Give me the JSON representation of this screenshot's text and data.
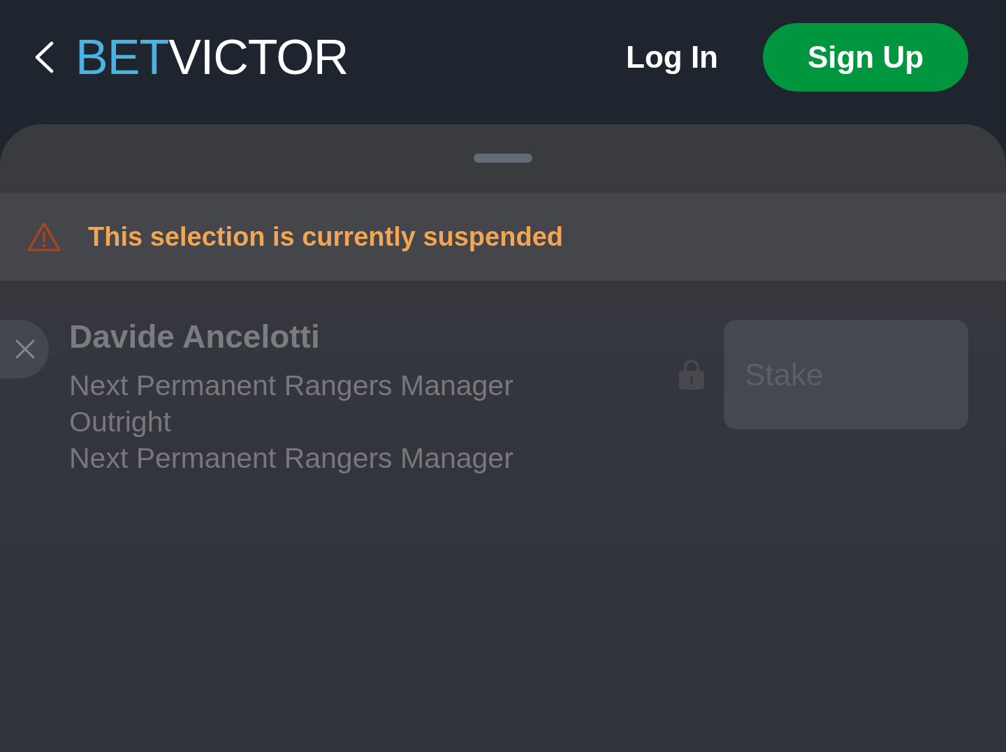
{
  "header": {
    "logo": {
      "accent": "BET",
      "rest": "VICTOR"
    },
    "login": "Log In",
    "signup": "Sign Up"
  },
  "sheet": {
    "alert": {
      "kind": "warning",
      "text": "This selection is currently suspended"
    },
    "selections": [
      {
        "name": "Davide Ancelotti",
        "lines": [
          "Next Permanent Rangers Manager",
          "Outright",
          "Next Permanent Rangers Manager"
        ],
        "suspended": true,
        "stake": {
          "placeholder": "Stake",
          "disabled": true
        }
      }
    ]
  }
}
